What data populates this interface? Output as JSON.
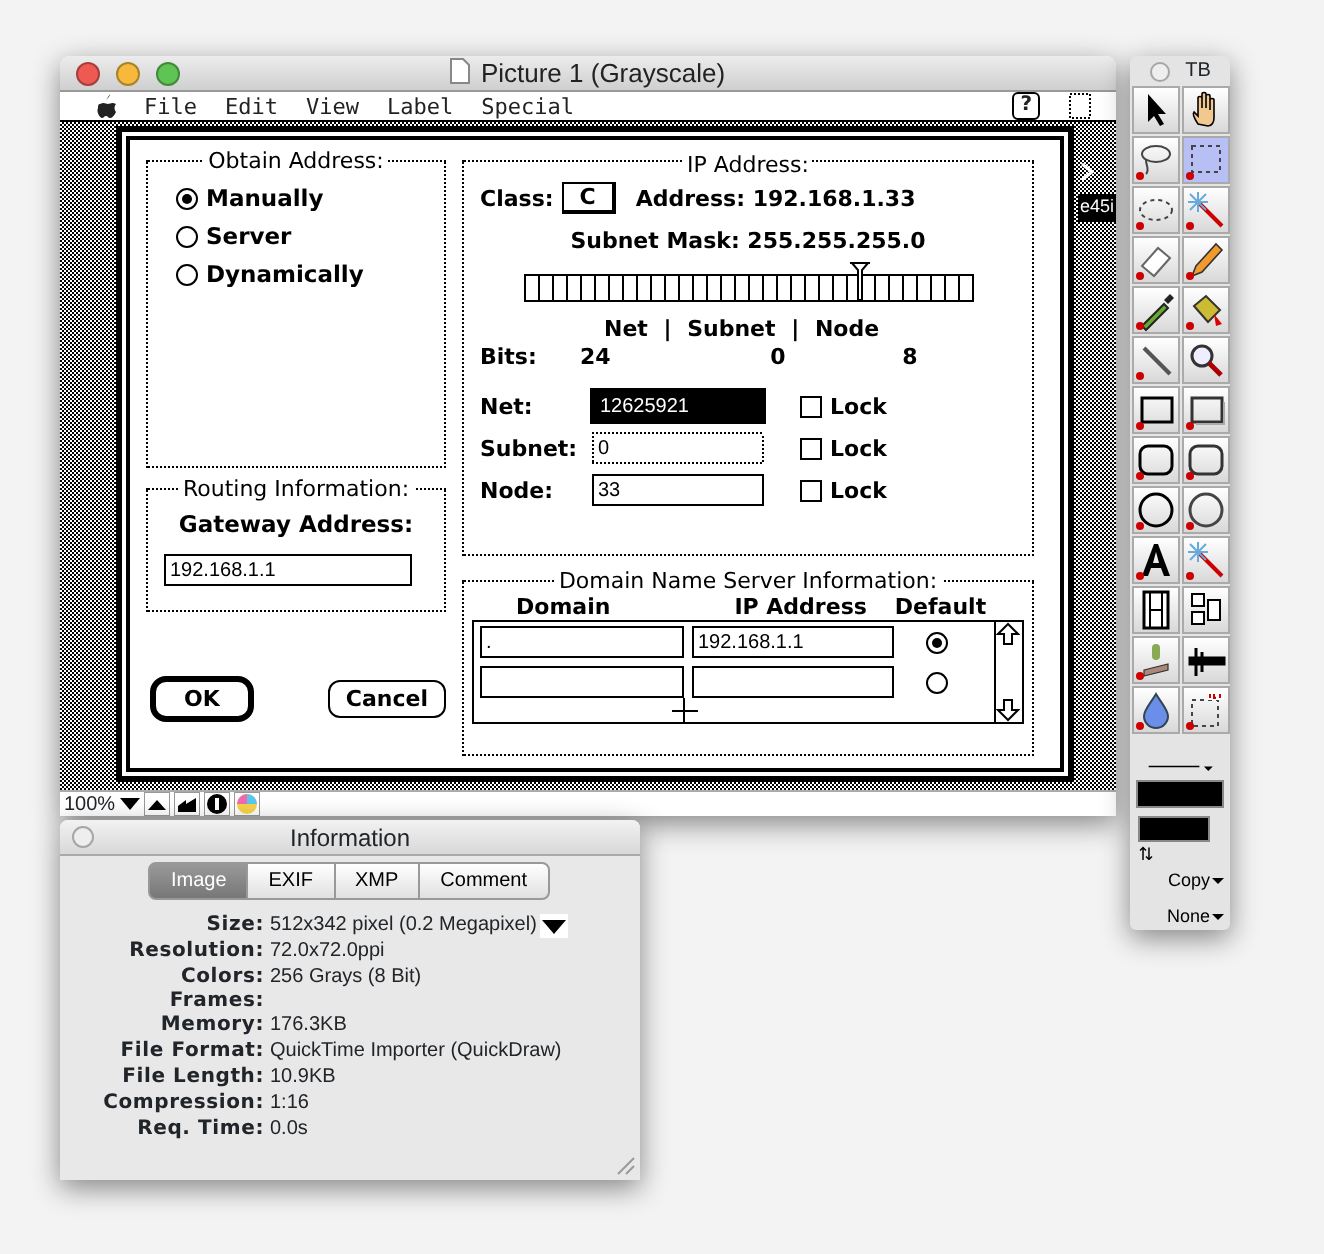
{
  "window": {
    "title": "Picture 1 (Grayscale)"
  },
  "menu_bar": {
    "items": [
      "File",
      "Edit",
      "View",
      "Label",
      "Special"
    ],
    "help": "?"
  },
  "side_label": "e45i",
  "dialog": {
    "obtain_address": {
      "title": "Obtain Address:",
      "options": [
        {
          "label": "Manually",
          "selected": true
        },
        {
          "label": "Server",
          "selected": false
        },
        {
          "label": "Dynamically",
          "selected": false
        }
      ]
    },
    "routing": {
      "title": "Routing Information:",
      "label": "Gateway Address:",
      "value": "192.168.1.1"
    },
    "buttons": [
      {
        "label": "OK",
        "default": true
      },
      {
        "label": "Cancel",
        "default": false
      }
    ],
    "ip_address": {
      "title": "IP Address:",
      "class_label": "Class:",
      "class_value": "C",
      "address": "Address: 192.168.1.33",
      "subnet_mask": "Subnet Mask: 255.255.255.0",
      "slider": {
        "level": 0.75
      },
      "bits_header": "Net | Subnet | Node",
      "bits_label": "Bits:",
      "bits": [
        "24",
        "0",
        "8"
      ],
      "fields": [
        {
          "label": "Net:",
          "value": "12625921",
          "selected": true,
          "disabled": false,
          "lock": "Lock",
          "checked": false
        },
        {
          "label": "Subnet:",
          "value": "0",
          "selected": false,
          "disabled": true,
          "lock": "Lock",
          "checked": false
        },
        {
          "label": "Node:",
          "value": "33",
          "selected": false,
          "disabled": false,
          "lock": "Lock",
          "checked": false
        }
      ]
    },
    "dns": {
      "title": "Domain Name Server Information:",
      "columns": [
        "Domain",
        "IP Address",
        "Default"
      ],
      "rows": [
        {
          "domain": ".",
          "ip": "192.168.1.1",
          "selected": true
        },
        {
          "selected": false
        }
      ]
    }
  },
  "status_bar": {
    "zoom": "100%"
  },
  "info_window": {
    "title": "Information",
    "tabs": [
      {
        "label": "Image",
        "selected": true
      },
      {
        "label": "EXIF",
        "selected": false
      },
      {
        "label": "XMP",
        "selected": false
      },
      {
        "label": "Comment",
        "selected": false
      }
    ],
    "rows": [
      {
        "label": "Size:",
        "value": "512x342 pixel (0.2 Megapixel)",
        "kind": "dropdown"
      },
      {
        "label": "Resolution:",
        "value": "72.0x72.0ppi",
        "kind": "text"
      },
      {
        "label": "Colors:",
        "value": "256 Grays (8 Bit)",
        "kind": "text"
      },
      {
        "label": "Frames:",
        "kind": "text"
      },
      {
        "label": "Memory:",
        "value": "176.3KB",
        "kind": "text"
      },
      {
        "label": "File Format:",
        "value": "QuickTime Importer (QuickDraw)",
        "kind": "text"
      },
      {
        "label": "File Length:",
        "value": "10.9KB",
        "kind": "text"
      },
      {
        "label": "Compression:",
        "value": "1:16",
        "kind": "text"
      },
      {
        "label": "Req. Time:",
        "value": "0.0s",
        "kind": "text"
      }
    ]
  },
  "tool_palette": {
    "title": "TB",
    "tools": [
      {
        "kind": "arrow",
        "selected": false,
        "menu": false
      },
      {
        "kind": "hand",
        "selected": false,
        "menu": false
      },
      {
        "kind": "lasso",
        "selected": false,
        "menu": true
      },
      {
        "kind": "marquee",
        "selected": true,
        "menu": true
      },
      {
        "kind": "ellipse-select",
        "selected": false,
        "menu": true
      },
      {
        "kind": "wand",
        "selected": false,
        "menu": true
      },
      {
        "kind": "eraser",
        "selected": false,
        "menu": true
      },
      {
        "kind": "pencil",
        "selected": false,
        "menu": true
      },
      {
        "kind": "eyedropper",
        "selected": false,
        "menu": true
      },
      {
        "kind": "bucket",
        "selected": false,
        "menu": true
      },
      {
        "kind": "line",
        "selected": false,
        "menu": true
      },
      {
        "kind": "magnifier",
        "selected": false,
        "menu": false
      },
      {
        "kind": "rect",
        "selected": false,
        "menu": true
      },
      {
        "kind": "rect-shadow",
        "selected": false,
        "menu": true
      },
      {
        "kind": "roundrect",
        "selected": false,
        "menu": true
      },
      {
        "kind": "roundrect-shadow",
        "selected": false,
        "menu": true
      },
      {
        "kind": "oval",
        "selected": false,
        "menu": true
      },
      {
        "kind": "oval-shadow",
        "selected": false,
        "menu": true
      },
      {
        "kind": "text",
        "selected": false,
        "menu": true
      },
      {
        "kind": "wand",
        "selected": false,
        "menu": true
      },
      {
        "kind": "film",
        "selected": false,
        "menu": false
      },
      {
        "kind": "layout",
        "selected": false,
        "menu": false
      },
      {
        "kind": "stamp",
        "selected": false,
        "menu": true
      },
      {
        "kind": "caliper",
        "selected": false,
        "menu": false
      },
      {
        "kind": "drop",
        "selected": false,
        "menu": true
      },
      {
        "kind": "jpg",
        "selected": false,
        "menu": true
      }
    ],
    "dropdowns": [
      "Copy",
      "None"
    ]
  }
}
